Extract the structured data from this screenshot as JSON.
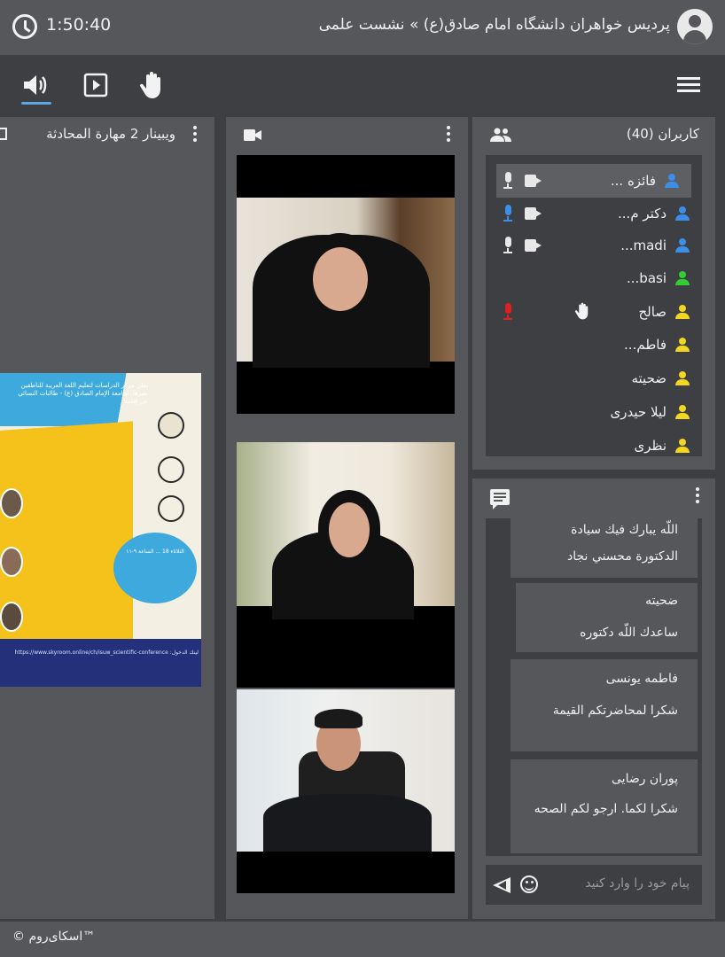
{
  "header": {
    "timer": "1:50:40",
    "title": "پردیس خواهران دانشگاه امام صادق(ع) » نشست علمی"
  },
  "toolbar": {
    "speaker_icon": "speaker-icon",
    "present_icon": "play-icon",
    "hand_icon": "raise-hand-icon",
    "menu_icon": "hamburger-menu-icon"
  },
  "presentation": {
    "title": "ویبینار 2 مهارة المحادثة",
    "poster": {
      "header": "يعلن مركز الدراسات لتعليم اللغة العربية للناطقين بغيرها، لجامعة الإمام الصادق (ع) - طالبات النسائي عن إقامة",
      "footer": "لينك الدخول: https://www.skyroom.online/ch/isuw_scientific-conference",
      "event": "الثلاثاء 18 ... الساعة ٩-١١"
    }
  },
  "users": {
    "title": "کاربران (40)",
    "items": [
      {
        "name": "فائزه ...",
        "role_color": "#3d8ee8",
        "mic": "on",
        "cam": true,
        "selected": true
      },
      {
        "name": "دکتر م...",
        "role_color": "#3d8ee8",
        "mic": "active",
        "cam": true
      },
      {
        "name": "madi...",
        "role_color": "#3d8ee8",
        "mic": "on",
        "cam": true
      },
      {
        "name": "basi...",
        "role_color": "#33cc33",
        "mic": "none",
        "cam": false
      },
      {
        "name": "صالح",
        "role_color": "#f1d622",
        "mic": "muted",
        "cam": false,
        "hand": true
      },
      {
        "name": "فاطم...",
        "role_color": "#f1d622",
        "mic": "none",
        "cam": false
      },
      {
        "name": "ضحیته",
        "role_color": "#f1d622",
        "mic": "none",
        "cam": false
      },
      {
        "name": "لیلا حیدری",
        "role_color": "#f1d622",
        "mic": "none",
        "cam": false
      },
      {
        "name": "نظری",
        "role_color": "#f1d622",
        "mic": "none",
        "cam": false
      }
    ]
  },
  "chat": {
    "messages": [
      {
        "author": "",
        "lines": [
          "اللّه يبارك فيك سيادة",
          "الدكتورة محسني نجاد"
        ]
      },
      {
        "author": "ضحیته",
        "lines": [
          "ساعدك اللّه دكتوره"
        ]
      },
      {
        "author": "فاطمه یونسی",
        "lines": [
          "شكرا لمحاضرتكم القيمة"
        ]
      },
      {
        "author": "پوران رضایی",
        "lines": [
          "شكرا لكما. ارجو لكم الصحه"
        ]
      }
    ],
    "placeholder": "پیام خود را وارد کنید"
  },
  "footer": {
    "brand": "© اسکای‌روم™"
  },
  "colors": {
    "accent_blue": "#5aa8e6",
    "mic_active_blue": "#3d8ee8",
    "mic_muted_red": "#e02020",
    "panel": "#55575b",
    "background": "#3d3f43"
  }
}
